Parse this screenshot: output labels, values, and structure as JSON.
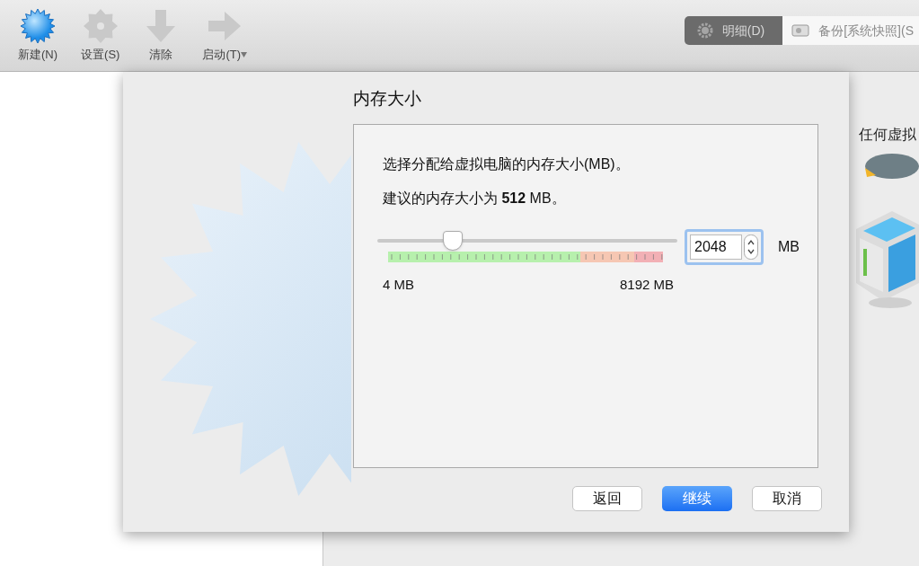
{
  "toolbar": {
    "items": [
      {
        "kind": "new",
        "label": "新建(N)",
        "disabled": false,
        "menu": false
      },
      {
        "kind": "settings",
        "label": "设置(S)",
        "disabled": true,
        "menu": false
      },
      {
        "kind": "clear",
        "label": "清除",
        "disabled": true,
        "menu": false
      },
      {
        "kind": "start",
        "label": "启动(T)",
        "disabled": true,
        "menu": true
      }
    ]
  },
  "view_tabs": [
    {
      "kind": "details",
      "label": "明细(D)",
      "selected": true
    },
    {
      "kind": "snapshots",
      "label": "备份[系统快照](S",
      "selected": false
    }
  ],
  "welcome": {
    "fragment": "任何虚拟"
  },
  "dialog": {
    "title": "内存大小",
    "description": "选择分配给虚拟电脑的内存大小(MB)。",
    "recommendation": "建议的内存大小为 **512** MB。",
    "slider": {
      "level": 0.25,
      "min_label": "4 MB",
      "max_label": "8192 MB"
    },
    "memory_field": {
      "value": "2048",
      "unit": "MB"
    },
    "buttons": [
      {
        "kind": "default",
        "label": "返回"
      },
      {
        "kind": "primary",
        "label": "继续"
      },
      {
        "kind": "default",
        "label": "取消"
      }
    ]
  }
}
